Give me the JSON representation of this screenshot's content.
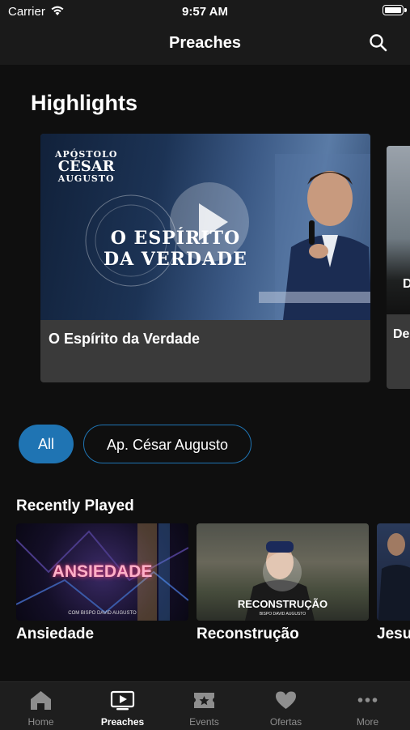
{
  "status_bar": {
    "carrier": "Carrier",
    "time": "9:57 AM"
  },
  "nav": {
    "title": "Preaches"
  },
  "highlights": {
    "title": "Highlights",
    "cards": [
      {
        "caption": "O Espírito da Verdade",
        "art_top_1": "APÓSTOLO",
        "art_top_2": "CÉSAR",
        "art_top_3": "AUGUSTO",
        "art_title_1": "O ESPÍRITO",
        "art_title_2": "DA VERDADE",
        "art_ring": "APÓSTOLO CÉSAR AUGUSTO"
      },
      {
        "caption": "De Sé",
        "art_partial": "D"
      }
    ]
  },
  "filters": [
    {
      "label": "All",
      "selected": true
    },
    {
      "label": "Ap. César Augusto",
      "selected": false
    }
  ],
  "recently_played": {
    "title": "Recently Played",
    "items": [
      {
        "title": "Ansiedade",
        "art_text": "ANSIEDADE",
        "art_sub": "COM BISPO DAVID AUGUSTO"
      },
      {
        "title": "Reconstrução",
        "art_text": "RECONSTRUÇÃO",
        "art_sub": "BISPO DAVID AUGUSTO"
      },
      {
        "title": "Jesu"
      }
    ]
  },
  "tab_bar": {
    "tabs": [
      {
        "label": "Home",
        "icon": "home-icon",
        "active": false
      },
      {
        "label": "Preaches",
        "icon": "tv-play-icon",
        "active": true
      },
      {
        "label": "Events",
        "icon": "ticket-icon",
        "active": false
      },
      {
        "label": "Ofertas",
        "icon": "heart-icon",
        "active": false
      },
      {
        "label": "More",
        "icon": "more-dots-icon",
        "active": false
      }
    ]
  },
  "colors": {
    "accent": "#1f74b3",
    "background": "#0f0f0f",
    "bar": "#1a1a1a",
    "card": "#3a3a3a"
  }
}
